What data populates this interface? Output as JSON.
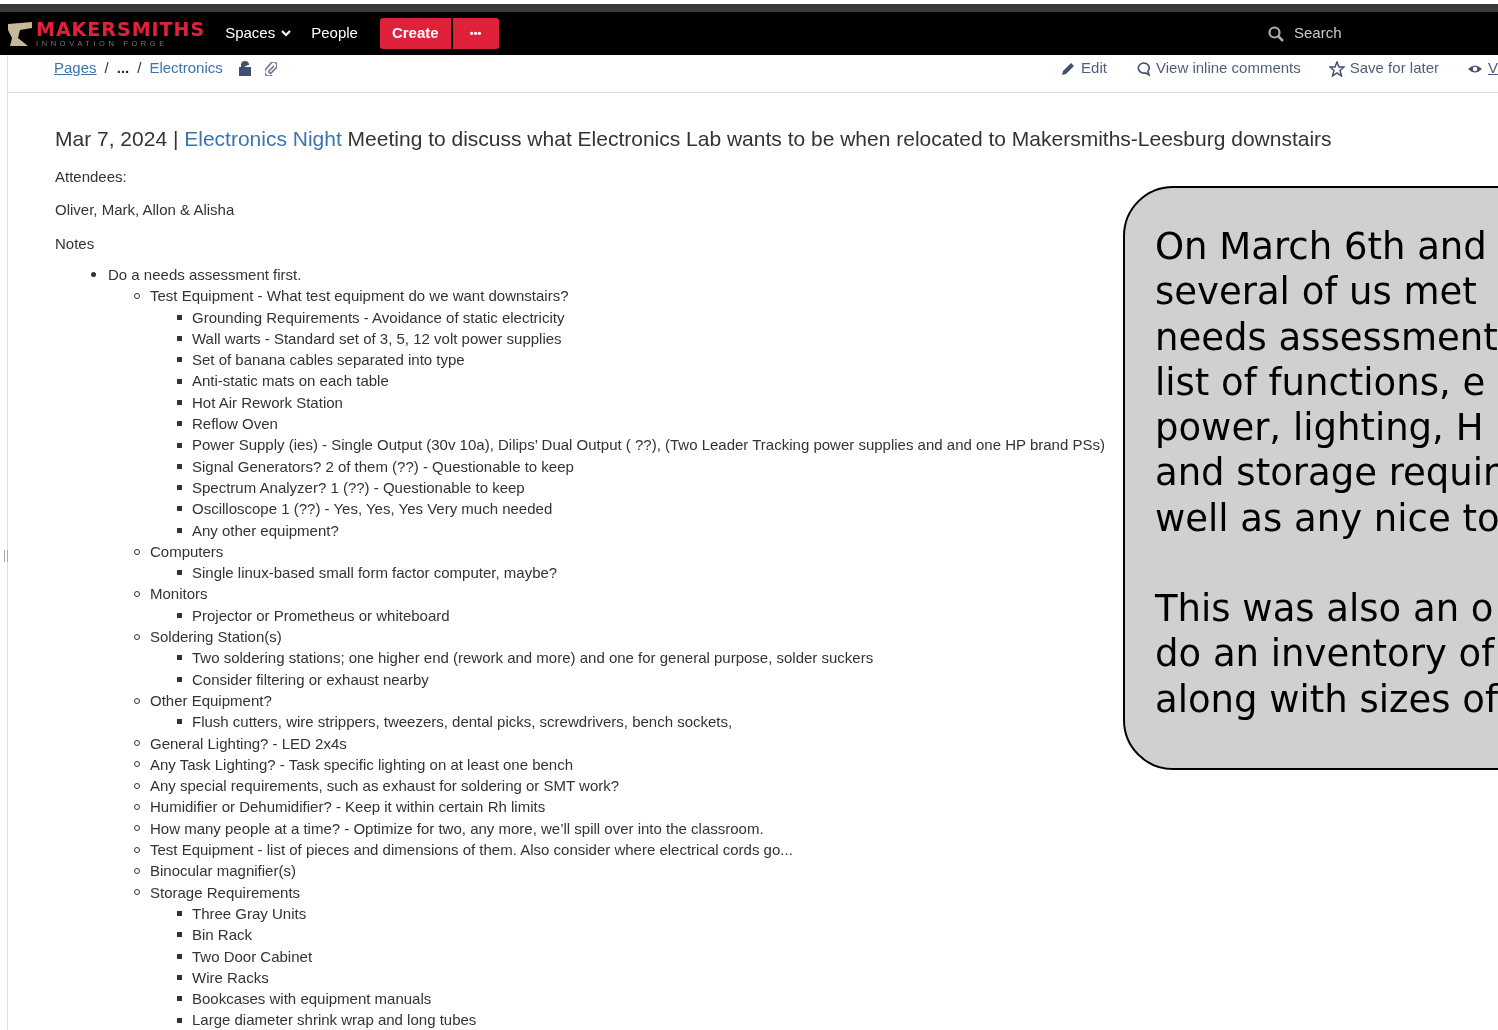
{
  "header": {
    "logo": {
      "name": "MAKERSMITHS",
      "tagline": "INNOVATION FORGE"
    },
    "nav": [
      {
        "label": "Spaces",
        "kind": "dropdown"
      },
      {
        "label": "People",
        "kind": "link"
      }
    ],
    "create_button": "Create",
    "more_button": "•••",
    "search": {
      "placeholder": "Search"
    }
  },
  "breadcrumbs": [
    {
      "label": "Pages",
      "kind": "link"
    },
    {
      "label": "/",
      "kind": "separator"
    },
    {
      "label": "...",
      "kind": "ellipsis"
    },
    {
      "label": "/",
      "kind": "separator"
    },
    {
      "label": "Electronics",
      "kind": "link"
    }
  ],
  "page_actions": [
    {
      "label": "Edit",
      "kind": "edit"
    },
    {
      "label": "View inline comments",
      "kind": "comments"
    },
    {
      "label": "Save for later",
      "kind": "save"
    },
    {
      "label": "V",
      "kind": "watch"
    }
  ],
  "title": {
    "date": "Mar 7, 2024 |",
    "link": "Electronics Night",
    "rest": "Meeting to discuss what Electronics Lab wants to be when relocated to Makersmiths-Leesburg downstairs"
  },
  "paragraphs": [
    "Attendees:",
    "Oliver, Mark, Allon & Alisha",
    "Notes"
  ],
  "notes": [
    {
      "text": "Do a needs assessment first.",
      "children": [
        {
          "text": "Test Equipment - What test equipment do we want downstairs?",
          "children": [
            {
              "text": "Grounding Requirements - Avoidance of static electricity"
            },
            {
              "text": "Wall warts - Standard set of 3, 5, 12 volt power supplies"
            },
            {
              "text": "Set of banana cables  separated into type"
            },
            {
              "text": "Anti-static mats on each table"
            },
            {
              "text": "Hot Air Rework Station"
            },
            {
              "text": "Reflow Oven"
            },
            {
              "text": "Power Supply (ies) - Single Output (30v 10a), Dilips’ Dual Output ( ??),  (Two Leader Tracking power supplies and and one HP brand PSs)"
            },
            {
              "text": "Signal Generators?  2 of them (??) - Questionable to keep"
            },
            {
              "text": "Spectrum Analyzer?  1  (??) - Questionable to keep"
            },
            {
              "text": "Oscilloscope 1 (??) - Yes, Yes, Yes  Very much needed"
            },
            {
              "text": "Any other equipment?"
            }
          ]
        },
        {
          "text": "Computers",
          "children": [
            {
              "text": "Single linux-based small form factor computer, maybe?"
            }
          ]
        },
        {
          "text": "Monitors",
          "children": [
            {
              "text": "Projector or Prometheus or whiteboard"
            }
          ]
        },
        {
          "text": "Soldering Station(s)",
          "children": [
            {
              "text": "Two soldering stations; one higher end (rework and more) and one for general purpose, solder suckers"
            },
            {
              "text": "Consider filtering or exhaust nearby"
            }
          ]
        },
        {
          "text": "Other Equipment?",
          "children": [
            {
              "text": "Flush cutters, wire strippers, tweezers, dental picks, screwdrivers, bench sockets,"
            }
          ]
        },
        {
          "text": "General Lighting? - LED 2x4s"
        },
        {
          "text": "Any Task Lighting? - Task specific lighting on at least one bench"
        },
        {
          "text": "Any special requirements, such as exhaust for soldering or SMT work?"
        },
        {
          "text": "Humidifier or Dehumidifier? - Keep it within certain Rh limits"
        },
        {
          "text": "How many people at a time? - Optimize for two, any more, we’ll spill over into the classroom."
        },
        {
          "text": "Test Equipment - list of pieces and dimensions of them.  Also consider where electrical cords go..."
        },
        {
          "text": "Binocular magnifier(s)"
        },
        {
          "text": "Storage Requirements",
          "children": [
            {
              "text": "Three Gray Units"
            },
            {
              "text": "Bin Rack"
            },
            {
              "text": "Two Door Cabinet"
            },
            {
              "text": "Wire Racks"
            },
            {
              "text": "Bookcases with equipment manuals"
            },
            {
              "text": "Large diameter shrink wrap and long tubes"
            }
          ]
        }
      ]
    }
  ],
  "callout": {
    "paragraphs": [
      [
        "On March 6th and",
        "several of us met",
        "needs assessment",
        "list of functions, e",
        "power, lighting, H",
        "and storage requir",
        "well as any nice to"
      ],
      [
        "This was also an o",
        "do an inventory of",
        "along with sizes of"
      ]
    ]
  }
}
